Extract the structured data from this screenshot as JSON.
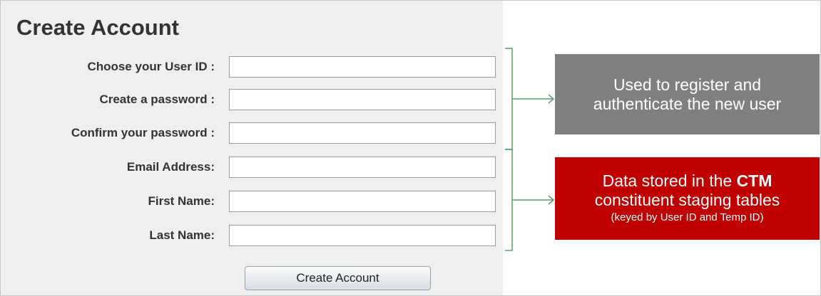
{
  "form": {
    "title": "Create Account",
    "fields": [
      {
        "label": "Choose your User ID :",
        "value": ""
      },
      {
        "label": "Create a password :",
        "value": ""
      },
      {
        "label": "Confirm your password :",
        "value": ""
      },
      {
        "label": "Email Address:",
        "value": ""
      },
      {
        "label": "First Name:",
        "value": ""
      },
      {
        "label": "Last Name:",
        "value": ""
      }
    ],
    "submit_label": "Create Account"
  },
  "callouts": {
    "auth": {
      "line1": "Used to register and",
      "line2": "authenticate the new user",
      "color": "#808080"
    },
    "ctm": {
      "line1_prefix": "Data stored in the ",
      "line1_emphasis": "CTM",
      "line2": "constituent staging tables",
      "line3": "(keyed by User ID and Temp ID)",
      "color": "#c00000"
    },
    "brace_color": "#5a9e6f",
    "arrow_icon": "right-arrow"
  }
}
